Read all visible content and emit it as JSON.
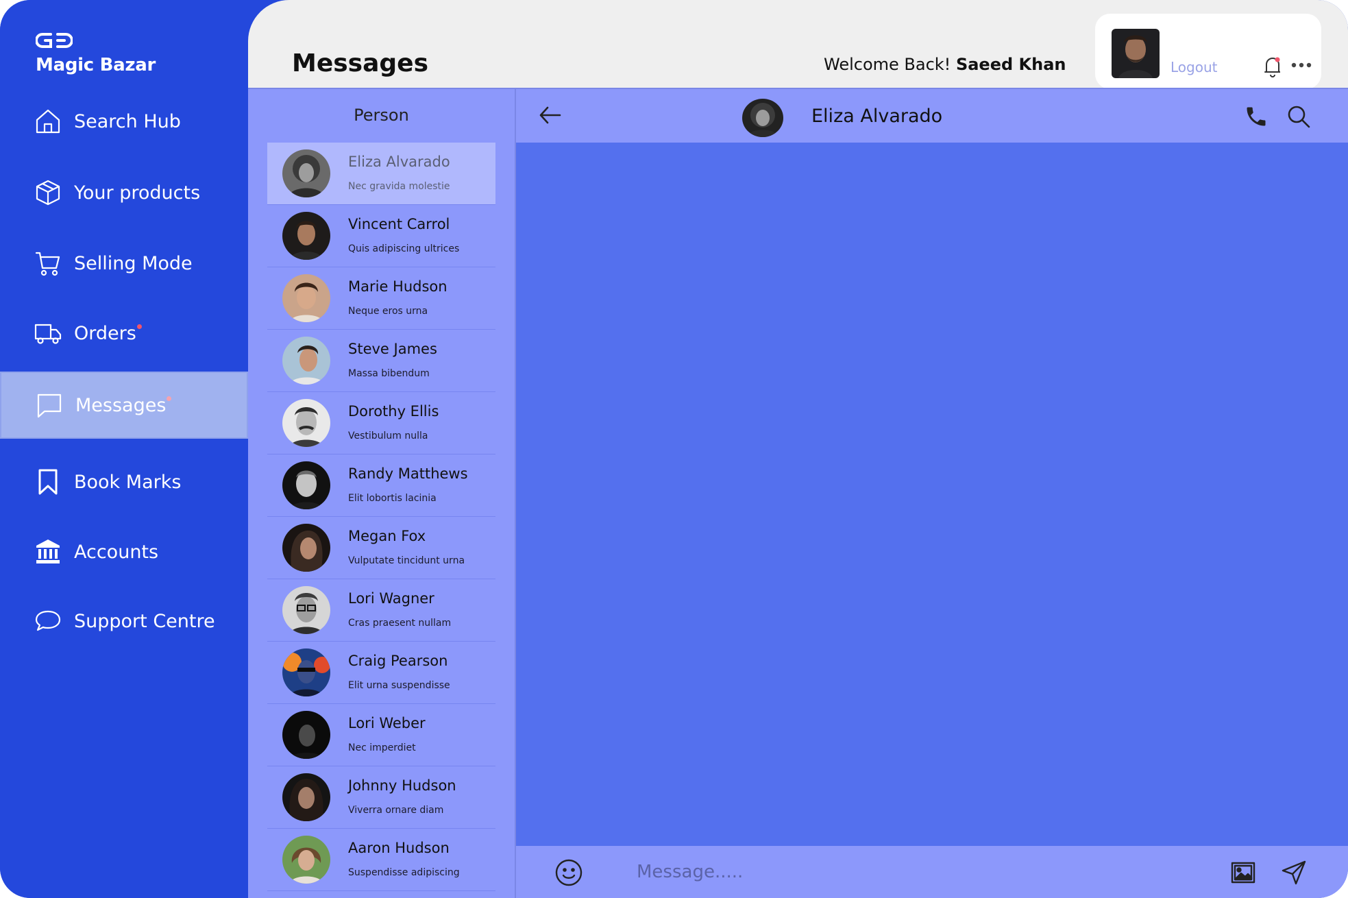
{
  "brand": {
    "name": "Magic Bazar"
  },
  "sidebar": {
    "items": [
      {
        "label": "Search Hub",
        "icon": "home-icon",
        "active": false,
        "dot": false
      },
      {
        "label": "Your products",
        "icon": "box-icon",
        "active": false,
        "dot": false
      },
      {
        "label": "Selling Mode",
        "icon": "cart-icon",
        "active": false,
        "dot": false
      },
      {
        "label": "Orders",
        "icon": "truck-icon",
        "active": false,
        "dot": true
      },
      {
        "label": "Messages",
        "icon": "chat-bubble-icon",
        "active": true,
        "dot": true
      },
      {
        "label": "Book Marks",
        "icon": "bookmark-icon",
        "active": false,
        "dot": false
      },
      {
        "label": "Accounts",
        "icon": "bank-icon",
        "active": false,
        "dot": false
      },
      {
        "label": "Support Centre",
        "icon": "speech-bubble-icon",
        "active": false,
        "dot": false
      }
    ]
  },
  "header": {
    "title": "Messages",
    "welcome_prefix": "Welcome Back!",
    "user_name": "Saeed Khan",
    "logout_label": "Logout"
  },
  "contacts": {
    "header": "Person",
    "items": [
      {
        "name": "Eliza Alvarado",
        "message": "Nec gravida molestie",
        "selected": true
      },
      {
        "name": "Vincent Carrol",
        "message": "Quis adipiscing ultrices",
        "selected": false
      },
      {
        "name": "Marie Hudson",
        "message": "Neque eros urna",
        "selected": false
      },
      {
        "name": "Steve James",
        "message": "Massa bibendum",
        "selected": false
      },
      {
        "name": "Dorothy Ellis",
        "message": "Vestibulum nulla",
        "selected": false
      },
      {
        "name": "Randy Matthews",
        "message": "Elit lobortis lacinia",
        "selected": false
      },
      {
        "name": "Megan Fox",
        "message": "Vulputate tincidunt urna",
        "selected": false
      },
      {
        "name": "Lori Wagner",
        "message": "Cras praesent nullam",
        "selected": false
      },
      {
        "name": "Craig Pearson",
        "message": "Elit urna suspendisse",
        "selected": false
      },
      {
        "name": "Lori Weber",
        "message": "Nec imperdiet",
        "selected": false
      },
      {
        "name": "Johnny Hudson",
        "message": "Viverra ornare diam",
        "selected": false
      },
      {
        "name": "Aaron Hudson",
        "message": "Suspendisse adipiscing",
        "selected": false
      }
    ]
  },
  "chat": {
    "contact_name": "Eliza Alvarado",
    "input_placeholder": "Message....."
  },
  "colors": {
    "sidebar": "#2448dc",
    "active_item": "#a0b2ef",
    "panel": "#8c98fb",
    "chat_bg": "#5470ee",
    "notification_dot": "#f1556b"
  }
}
